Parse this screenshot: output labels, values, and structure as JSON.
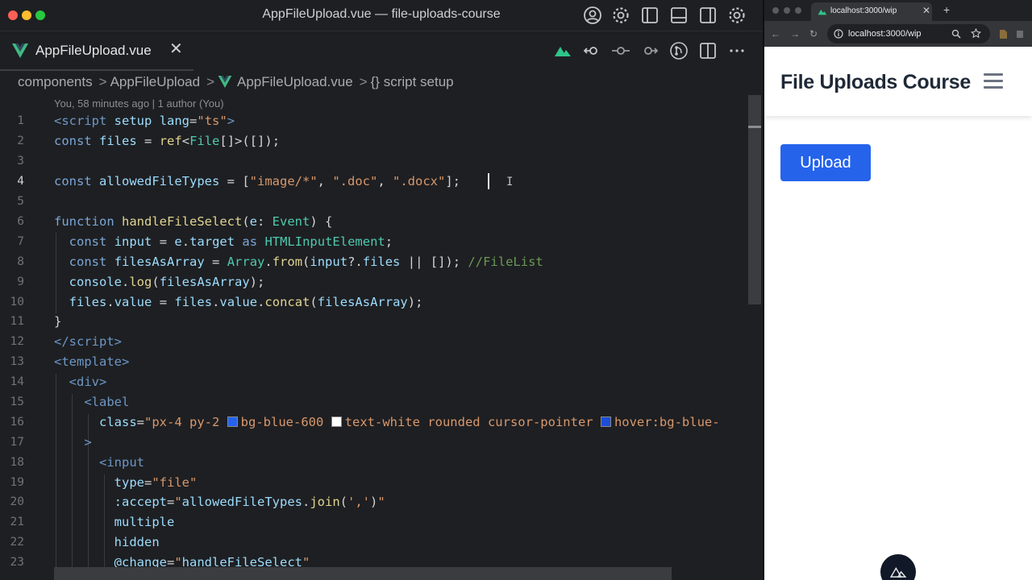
{
  "editor": {
    "window_title": "AppFileUpload.vue — file-uploads-course",
    "tab_title": "AppFileUpload.vue",
    "tab_close": "✕",
    "breadcrumb": [
      "components",
      "AppFileUpload",
      "AppFileUpload.vue",
      "{} script setup"
    ],
    "breadcrumb_sep": ">",
    "blame": "You, 58 minutes ago | 1 author (You)",
    "line_numbers": [
      "1",
      "2",
      "3",
      "4",
      "5",
      "6",
      "7",
      "8",
      "9",
      "10",
      "11",
      "12",
      "13",
      "14",
      "15",
      "16",
      "17",
      "18",
      "19",
      "20",
      "21",
      "22",
      "23"
    ],
    "ibeam": "I"
  },
  "browser": {
    "tab_title": "localhost:3000/wip",
    "tab_close": "✕",
    "new_tab": "+",
    "nav_back": "←",
    "nav_forward": "→",
    "nav_reload": "↻",
    "url": "localhost:3000/wip",
    "page_title": "File Uploads Course",
    "upload_button": "Upload"
  },
  "colors": {
    "accent_blue": "#2563eb",
    "vue_green": "#41b883",
    "editor_bg": "#1e1f22"
  }
}
